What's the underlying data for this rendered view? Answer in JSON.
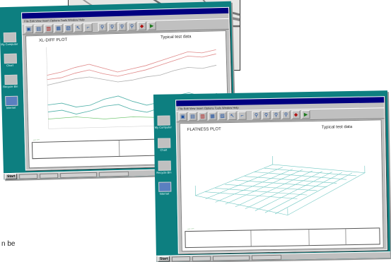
{
  "side_text": "n be",
  "screen1": {
    "menu": "File  Edit  View  Insert  Options  Tools  Window  Help",
    "plot_title": "XL-DIFF PLOT",
    "plot_subtitle": "Typical test data",
    "icons": [
      "My Computer",
      "Chart",
      "Recycle Bin",
      "Internet"
    ],
    "start_label": "Start"
  },
  "screen2": {
    "menu": "File  Edit  View  Insert  Options  Tools  Window  Help",
    "plot_title": "FLATNESS PLOT",
    "plot_subtitle": "Typical test data",
    "icons": [
      "My Computer",
      "Chart",
      "Recycle Bin",
      "Internet"
    ],
    "start_label": "Start"
  },
  "icon_names": [
    "new-icon",
    "open-icon",
    "save-icon",
    "chart-icon",
    "print-icon",
    "pointer-icon",
    "bracket-icon",
    "zoom-icon",
    "zoom-in-icon",
    "zoom-out-icon",
    "zoom-fit-icon",
    "color-icon",
    "export-icon"
  ]
}
